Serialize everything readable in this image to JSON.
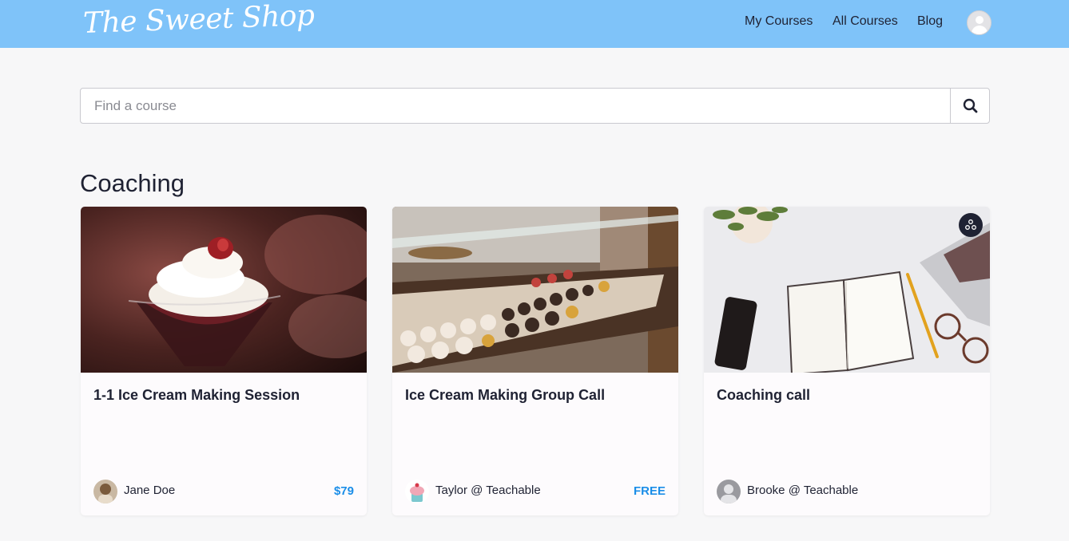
{
  "header": {
    "brand": "The Sweet Shop",
    "nav": {
      "my_courses": "My Courses",
      "all_courses": "All Courses",
      "blog": "Blog"
    }
  },
  "search": {
    "placeholder": "Find a course",
    "value": ""
  },
  "section": {
    "title": "Coaching"
  },
  "courses": [
    {
      "title": "1-1 Ice Cream Making Session",
      "author": "Jane Doe",
      "price": "$79"
    },
    {
      "title": "Ice Cream Making Group Call",
      "author": "Taylor @ Teachable",
      "price": "FREE"
    },
    {
      "title": "Coaching call",
      "author": "Brooke @ Teachable",
      "price": ""
    }
  ],
  "colors": {
    "header_bg": "#7fc3f9",
    "price": "#1b8ee8",
    "text": "#1f2233"
  },
  "icons": {
    "search": "search-icon",
    "avatar": "user-avatar-icon",
    "badge": "triangle-dots-icon"
  }
}
